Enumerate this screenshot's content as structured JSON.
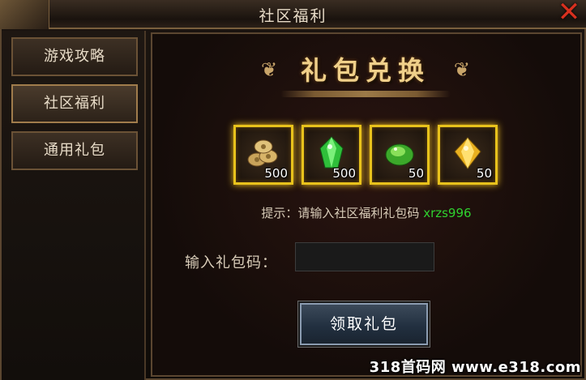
{
  "window": {
    "title": "社区福利"
  },
  "sidebar": {
    "items": [
      {
        "label": "游戏攻略"
      },
      {
        "label": "社区福利"
      },
      {
        "label": "通用礼包"
      }
    ]
  },
  "banner": {
    "title": "礼包兑换"
  },
  "rewards": [
    {
      "icon": "coin-stack-icon",
      "count": "500"
    },
    {
      "icon": "green-crystal-icon",
      "count": "500"
    },
    {
      "icon": "green-gem-icon",
      "count": "50"
    },
    {
      "icon": "gold-gem-icon",
      "count": "50"
    }
  ],
  "hint": {
    "prefix": "提示：请输入社区福利礼包码",
    "code": "xrzs996"
  },
  "form": {
    "label": "输入礼包码：",
    "value": "",
    "button": "领取礼包"
  },
  "watermark": "318首码网 www.e318.com",
  "colors": {
    "accent_gold": "#e8c21c",
    "code_green": "#2fd12f",
    "close_red": "#d8301e"
  }
}
